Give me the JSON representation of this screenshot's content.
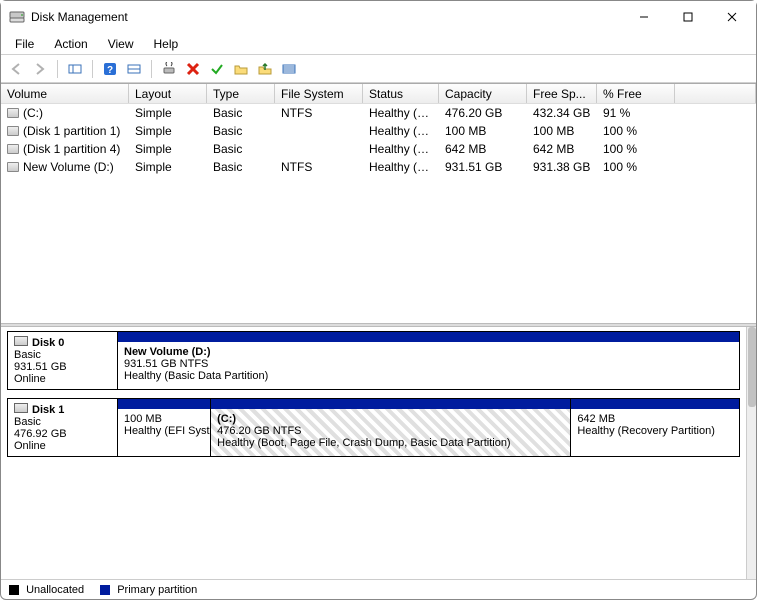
{
  "window": {
    "title": "Disk Management"
  },
  "menus": [
    "File",
    "Action",
    "View",
    "Help"
  ],
  "toolbar_icons": [
    "back-icon",
    "forward-icon",
    "show-hide-icon",
    "help-icon",
    "properties-icon",
    "refresh-icon",
    "delete-icon",
    "checkmark-icon",
    "folder-icon",
    "folder-up-icon",
    "list-icon"
  ],
  "columns": {
    "volume": "Volume",
    "layout": "Layout",
    "type": "Type",
    "fs": "File System",
    "status": "Status",
    "capacity": "Capacity",
    "free": "Free Sp...",
    "pct_free": "% Free"
  },
  "volumes": [
    {
      "name": "(C:)",
      "layout": "Simple",
      "type": "Basic",
      "fs": "NTFS",
      "status": "Healthy (B...",
      "capacity": "476.20 GB",
      "free": "432.34 GB",
      "pct_free": "91 %"
    },
    {
      "name": "(Disk 1 partition 1)",
      "layout": "Simple",
      "type": "Basic",
      "fs": "",
      "status": "Healthy (E...",
      "capacity": "100 MB",
      "free": "100 MB",
      "pct_free": "100 %"
    },
    {
      "name": "(Disk 1 partition 4)",
      "layout": "Simple",
      "type": "Basic",
      "fs": "",
      "status": "Healthy (R...",
      "capacity": "642 MB",
      "free": "642 MB",
      "pct_free": "100 %"
    },
    {
      "name": "New Volume (D:)",
      "layout": "Simple",
      "type": "Basic",
      "fs": "NTFS",
      "status": "Healthy (B...",
      "capacity": "931.51 GB",
      "free": "931.38 GB",
      "pct_free": "100 %"
    }
  ],
  "disks": [
    {
      "name": "Disk 0",
      "type": "Basic",
      "size": "931.51 GB",
      "state": "Online",
      "partitions": [
        {
          "title": "New Volume  (D:)",
          "line2": "931.51 GB NTFS",
          "line3": "Healthy (Basic Data Partition)",
          "width": "100%",
          "active": false
        }
      ]
    },
    {
      "name": "Disk 1",
      "type": "Basic",
      "size": "476.92 GB",
      "state": "Online",
      "partitions": [
        {
          "title": "",
          "line2": "100 MB",
          "line3": "Healthy (EFI System Partition)",
          "width": "15%",
          "active": false
        },
        {
          "title": "(C:)",
          "line2": "476.20 GB NTFS",
          "line3": "Healthy (Boot, Page File, Crash Dump, Basic Data Partition)",
          "width": "58%",
          "active": true
        },
        {
          "title": "",
          "line2": "642 MB",
          "line3": "Healthy (Recovery Partition)",
          "width": "27%",
          "active": false
        }
      ]
    }
  ],
  "legend": {
    "unallocated": "Unallocated",
    "primary": "Primary partition"
  }
}
